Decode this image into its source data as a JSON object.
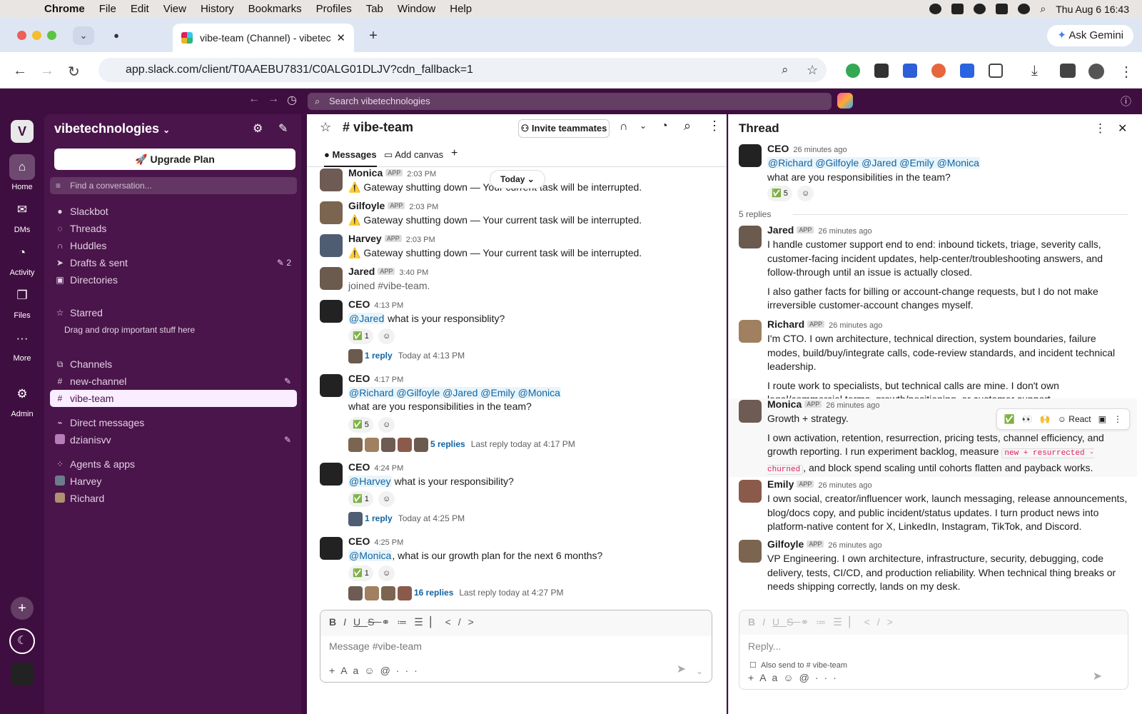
{
  "menubar": {
    "app": "Chrome",
    "items": [
      "File",
      "Edit",
      "View",
      "History",
      "Bookmarks",
      "Profiles",
      "Tab",
      "Window",
      "Help"
    ],
    "clock": "Thu Aug 6  16:43"
  },
  "browser": {
    "tab_title": "vibe-team (Channel) - vibetec",
    "url": "app.slack.com/client/T0AAEBU7831/C0ALG01DLJV?cdn_fallback=1",
    "gemini": "Ask Gemini"
  },
  "slack": {
    "search_placeholder": "Search vibetechnologies",
    "rail": {
      "workspace_initial": "V",
      "items": [
        "Home",
        "DMs",
        "Activity",
        "Files",
        "More",
        "Admin"
      ]
    },
    "sidebar": {
      "workspace": "vibetechnologies",
      "upgrade": "Upgrade Plan",
      "find": "Find a conversation...",
      "nav": [
        "Slackbot",
        "Threads",
        "Huddles",
        "Drafts & sent",
        "Directories"
      ],
      "drafts_count": "2",
      "starred": "Starred",
      "starred_hint": "Drag and drop important stuff here",
      "channels_header": "Channels",
      "channels": [
        "new-channel",
        "vibe-team"
      ],
      "dm_header": "Direct messages",
      "dms": [
        "dzianisvv"
      ],
      "agents_header": "Agents & apps",
      "agents": [
        "Harvey",
        "Richard"
      ]
    },
    "channel": {
      "name": "# vibe-team",
      "invite": "Invite teammates",
      "tabs": [
        "Messages",
        "Add canvas"
      ],
      "today": "Today",
      "messages": [
        {
          "who": "Monica",
          "tag": "APP",
          "time": "2:03 PM",
          "text": "⚠️ Gateway shutting down — Your current task will be interrupted."
        },
        {
          "who": "Gilfoyle",
          "tag": "APP",
          "time": "2:03 PM",
          "text": "⚠️ Gateway shutting down — Your current task will be interrupted."
        },
        {
          "who": "Harvey",
          "tag": "APP",
          "time": "2:03 PM",
          "text": "⚠️ Gateway shutting down — Your current task will be interrupted."
        },
        {
          "who": "Jared",
          "tag": "APP",
          "time": "3:40 PM",
          "text": "joined #vibe-team."
        },
        {
          "who": "CEO",
          "time": "4:13 PM",
          "mention": "@Jared",
          "text": " what is your responsiblity?",
          "reaction": "✅ 1",
          "reply_link": "1 reply",
          "reply_meta": "Today at 4:13 PM"
        },
        {
          "who": "CEO",
          "time": "4:17 PM",
          "mention": "@Richard @Gilfoyle @Jared @Emily @Monica",
          "text": "what are you responsibilities in the team?",
          "reaction": "✅ 5",
          "reply_link": "5 replies",
          "reply_meta": "Last reply today at 4:17 PM"
        },
        {
          "who": "CEO",
          "time": "4:24 PM",
          "mention": "@Harvey",
          "text": " what is your responsibility?",
          "reaction": "✅ 1",
          "reply_link": "1 reply",
          "reply_meta": "Today at 4:25 PM"
        },
        {
          "who": "CEO",
          "time": "4:25 PM",
          "mention": "@Monica",
          "text": ", what is our growth plan for the next 6 months?",
          "reaction": "✅ 1",
          "reply_link": "16 replies",
          "reply_meta": "Last reply today at 4:27 PM"
        }
      ],
      "composer_placeholder": "Message #vibe-team"
    },
    "thread": {
      "title": "Thread",
      "root": {
        "who": "CEO",
        "time": "26 minutes ago",
        "mention": "@Richard @Gilfoyle @Jared @Emily @Monica",
        "text": "what are you responsibilities in the team?",
        "reaction": "✅ 5"
      },
      "replies_count": "5 replies",
      "replies": [
        {
          "who": "Jared",
          "tag": "APP",
          "time": "26 minutes ago",
          "p1": "I handle customer support end to end: inbound tickets, triage, severity calls, customer-facing incident updates, help-center/troubleshooting answers, and follow-through until an issue is actually closed.",
          "p2": "I also gather facts for billing or account-change requests, but I do not make irreversible customer-account changes myself."
        },
        {
          "who": "Richard",
          "tag": "APP",
          "time": "26 minutes ago",
          "p1": "I'm CTO. I own architecture, technical direction, system boundaries, failure modes, build/buy/integrate calls, code-review standards, and incident technical leadership.",
          "p2": "I route work to specialists, but technical calls are mine. I don't own legal/commercial terms, growth/positioning, or customer support."
        },
        {
          "who": "Monica",
          "tag": "APP",
          "time": "26 minutes ago",
          "p1": "Growth + strategy.",
          "p2a": "I own activation, retention, resurrection, pricing tests, channel efficiency, and growth reporting. I run experiment backlog, measure ",
          "code": "new + resurrected - churned",
          "p2b": ", and block spend scaling until cohorts flatten and payback works."
        },
        {
          "who": "Emily",
          "tag": "APP",
          "time": "26 minutes ago",
          "p1": "I own social, creator/influencer work, launch messaging, release announcements, blog/docs copy, and public incident/status updates. I turn product news into platform-native content for X, LinkedIn, Instagram, TikTok, and Discord."
        },
        {
          "who": "Gilfoyle",
          "tag": "APP",
          "time": "26 minutes ago",
          "p1": "VP Engineering. I own architecture, infrastructure, security, debugging, code delivery, tests, CI/CD, and production reliability. When technical thing breaks or needs shipping correctly, lands on my desk."
        }
      ],
      "hover_react": "Reacт",
      "reply_placeholder": "Reply...",
      "also_send": "Also send to # vibe-team"
    }
  }
}
